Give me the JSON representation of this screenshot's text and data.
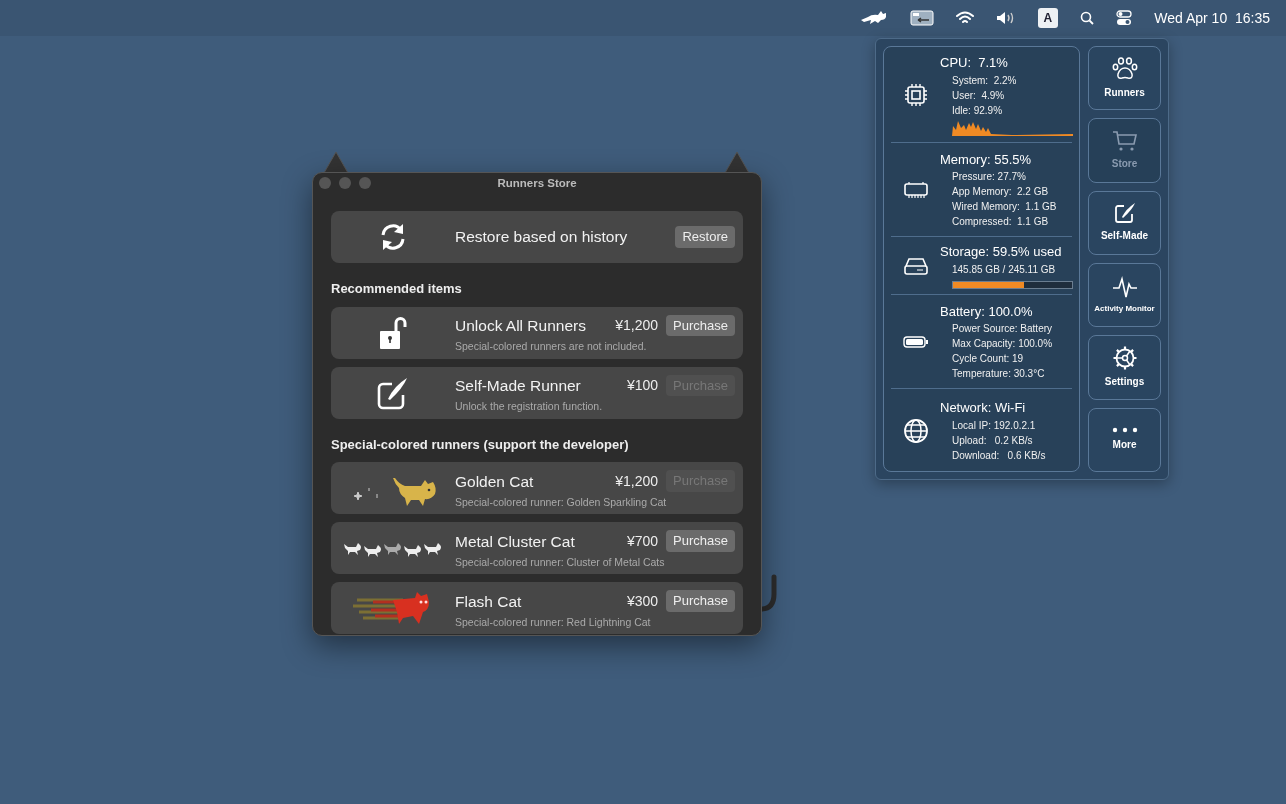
{
  "menu_bar": {
    "input_source": "A",
    "clock": "Wed Apr 10  16:35"
  },
  "store_window": {
    "title": "Runners Store",
    "restore": {
      "label": "Restore based on history",
      "button": "Restore"
    },
    "sections": [
      {
        "heading": "Recommended items",
        "items": [
          {
            "kind": "unlock",
            "name": "Unlock All Runners",
            "price": "¥1,200",
            "description": "Special-colored runners are not included.",
            "button": "Purchase",
            "disabled": false
          },
          {
            "kind": "compose",
            "name": "Self-Made Runner",
            "price": "¥100",
            "description": "Unlock the registration function.",
            "button": "Purchase",
            "disabled": true
          }
        ]
      },
      {
        "heading": "Special-colored runners (support the developer)",
        "items": [
          {
            "kind": "golden",
            "name": "Golden Cat",
            "price": "¥1,200",
            "description": "Special-colored runner: Golden Sparkling Cat",
            "button": "Purchase",
            "disabled": true
          },
          {
            "kind": "metal",
            "name": "Metal Cluster Cat",
            "price": "¥700",
            "description": "Special-colored runner: Cluster of Metal Cats",
            "button": "Purchase",
            "disabled": false
          },
          {
            "kind": "flash",
            "name": "Flash Cat",
            "price": "¥300",
            "description": "Special-colored runner: Red Lightning Cat",
            "button": "Purchase",
            "disabled": false
          }
        ]
      }
    ]
  },
  "system_panel": {
    "sections": [
      {
        "kind": "cpu",
        "title": "CPU:  7.1%",
        "lines": [
          "System:  2.2%",
          "User:  4.9%",
          "Idle: 92.9%"
        ]
      },
      {
        "kind": "memory",
        "title": "Memory: 55.5%",
        "lines": [
          "Pressure: 27.7%",
          "App Memory:  2.2 GB",
          "Wired Memory:  1.1 GB",
          "Compressed:  1.1 GB"
        ]
      },
      {
        "kind": "storage",
        "title": "Storage: 59.5% used",
        "lines": [
          "145.85 GB / 245.11 GB"
        ],
        "level": 0.595
      },
      {
        "kind": "battery",
        "title": "Battery: 100.0%",
        "lines": [
          "Power Source: Battery",
          "Max Capacity: 100.0%",
          "Cycle Count: 19",
          "Temperature: 30.3°C"
        ]
      },
      {
        "kind": "network",
        "title": "Network: Wi-Fi",
        "lines": [
          "Local IP: 192.0.2.1",
          "Upload:   0.2 KB/s",
          "Download:   0.6 KB/s"
        ]
      }
    ],
    "buttons": [
      {
        "kind": "paw",
        "label": "Runners",
        "disabled": false
      },
      {
        "kind": "cart",
        "label": "Store",
        "disabled": true
      },
      {
        "kind": "compose",
        "label": "Self-Made",
        "disabled": false
      },
      {
        "kind": "pulse",
        "label": "Activity Monitor",
        "disabled": false
      },
      {
        "kind": "gear",
        "label": "Settings",
        "disabled": false
      },
      {
        "kind": "dots",
        "label": "More",
        "disabled": false
      }
    ]
  }
}
